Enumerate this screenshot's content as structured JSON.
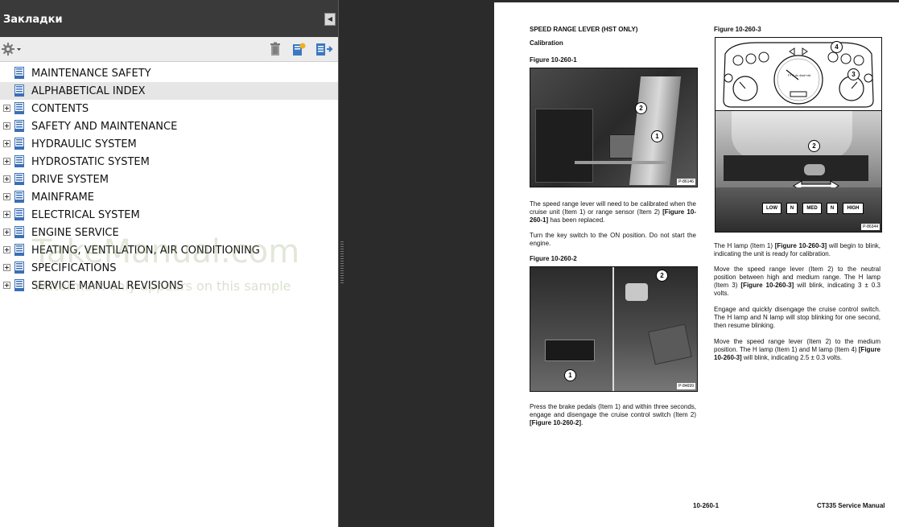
{
  "pane": {
    "title": "Закладки",
    "bookmarks": [
      {
        "label": "MAINTENANCE SAFETY",
        "expandable": false
      },
      {
        "label": "ALPHABETICAL INDEX",
        "expandable": false,
        "selected": true
      },
      {
        "label": "CONTENTS",
        "expandable": true
      },
      {
        "label": "SAFETY AND MAINTENANCE",
        "expandable": true
      },
      {
        "label": "HYDRAULIC SYSTEM",
        "expandable": true
      },
      {
        "label": "HYDROSTATIC SYSTEM",
        "expandable": true
      },
      {
        "label": "DRIVE SYSTEM",
        "expandable": true
      },
      {
        "label": "MAINFRAME",
        "expandable": true
      },
      {
        "label": "ELECTRICAL SYSTEM",
        "expandable": true
      },
      {
        "label": "ENGINE SERVICE",
        "expandable": true
      },
      {
        "label": "HEATING, VENTILATION, AIR CONDITIONING",
        "expandable": true
      },
      {
        "label": "SPECIFICATIONS",
        "expandable": true
      },
      {
        "label": "SERVICE MANUAL REVISIONS",
        "expandable": true
      }
    ],
    "watermark": "TakeManual.com",
    "watermark_sub": "Watermark only appears on this sample"
  },
  "doc": {
    "heading": "SPEED RANGE LEVER (HST ONLY)",
    "subheading": "Calibration",
    "fig1_title": "Figure 10-260-1",
    "fig1_code": "P-86146",
    "para1": [
      "The speed range lever will need to be calibrated when the cruise unit (Item 1) or range sensor (Item 2) ",
      "[Figure 10-260-1]",
      " has been replaced."
    ],
    "para2": "Turn the key switch to the ON position. Do not start the engine.",
    "fig2_title": "Figure 10-260-2",
    "fig2_code": "P-84699",
    "para3": [
      "Press the brake pedals (Item 1) and within three seconds, engage and disengage the cruise control switch (Item 2) ",
      "[Figure 10-260-2]",
      "."
    ],
    "fig3_title": "Figure 10-260-3",
    "fig3_code": "P-86344",
    "modes": [
      "LOW",
      "N",
      "MED",
      "N",
      "HIGH"
    ],
    "para4": [
      "The H lamp (Item 1) ",
      "[Figure 10-260-3]",
      " will begin to blink, indicating the unit is ready for calibration."
    ],
    "para5": [
      "Move the speed range lever (Item 2) to the neutral position between high and medium range. The H lamp (Item 3) ",
      "[Figure 10-260-3]",
      " will blink, indicating 3 ± 0.3 volts."
    ],
    "para6": "Engage and quickly disengage the cruise control switch. The H lamp and N lamp will stop blinking for one second, then resume blinking.",
    "para7": [
      "Move the speed range lever (Item 2) to the medium position. The H lamp (Item 1) and M lamp (Item 4) ",
      "[Figure 10-260-3]",
      " will blink, indicating 2.5 ± 0.3 volts."
    ],
    "footer_page": "10-260-1",
    "footer_manual": "CT335 Service Manual",
    "callouts": {
      "c1": "1",
      "c2": "2",
      "c3": "3",
      "c4": "4"
    },
    "gauge_text": "FTS dx 4wd+dd"
  }
}
